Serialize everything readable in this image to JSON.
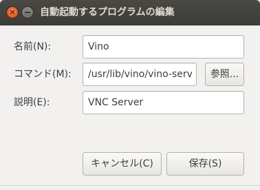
{
  "window": {
    "title": "自動起動するプログラムの編集",
    "close_glyph": "×"
  },
  "form": {
    "name_label": "名前(N):",
    "name_value": "Vino",
    "command_label": "コマンド(M):",
    "command_value": "/usr/lib/vino/vino-serv",
    "browse_label": "参照...",
    "comment_label": "説明(E):",
    "comment_value": "VNC Server"
  },
  "actions": {
    "cancel_label": "キャンセル(C)",
    "save_label": "保存(S)"
  },
  "colors": {
    "titlebar": "#3c3b37",
    "close_button": "#e2561f",
    "window_bg": "#f2f1f0"
  }
}
